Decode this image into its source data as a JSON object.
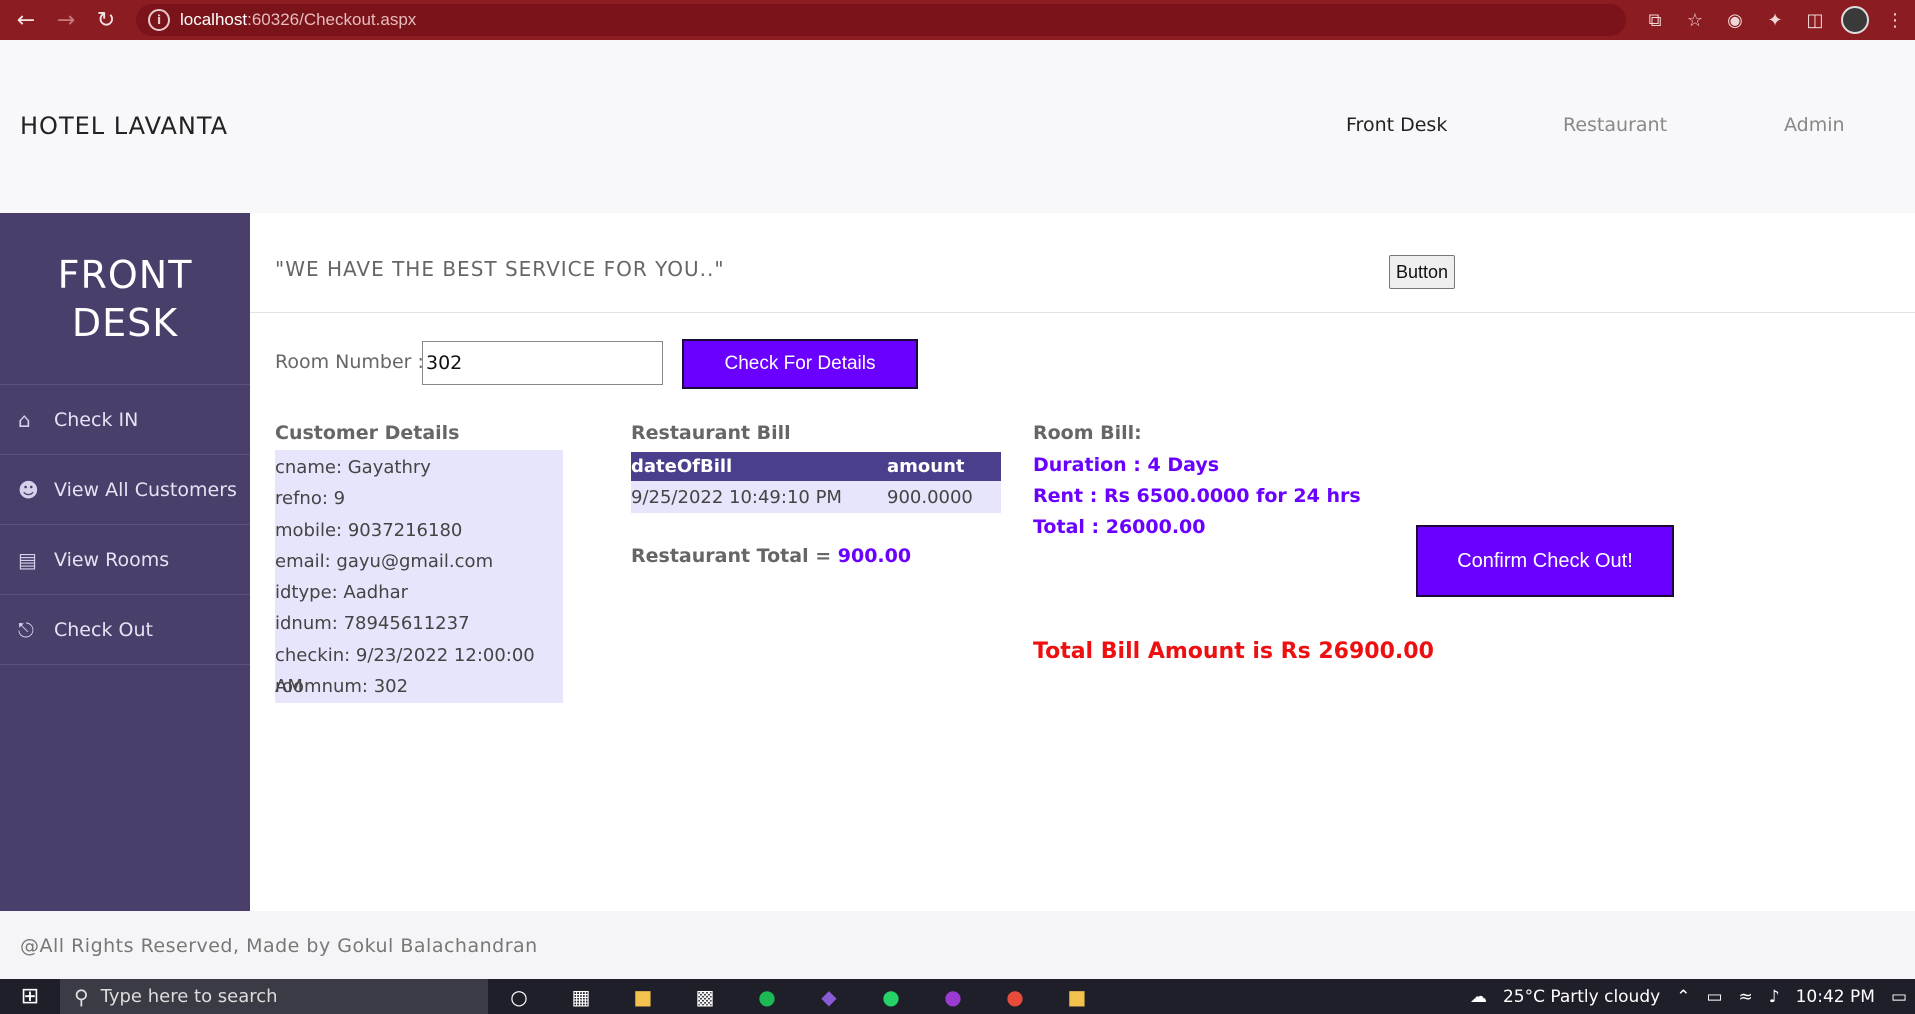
{
  "browser": {
    "url_host": "localhost",
    "url_rest": ":60326/Checkout.aspx"
  },
  "header": {
    "brand": "HOTEL LAVANTA",
    "nav": [
      "Front Desk",
      "Restaurant",
      "Admin"
    ]
  },
  "sidebar": {
    "title_line1": "FRONT",
    "title_line2": "DESK",
    "items": [
      {
        "label": "Check IN",
        "icon": "home-icon"
      },
      {
        "label": "View All Customers",
        "icon": "user-icon"
      },
      {
        "label": "View Rooms",
        "icon": "id-card-icon"
      },
      {
        "label": "Check Out",
        "icon": "sitemap-icon"
      }
    ]
  },
  "main": {
    "tagline": "\"WE HAVE THE BEST SERVICE FOR YOU..\"",
    "plain_button": "Button",
    "room_label": "Room Number :",
    "room_value": "302",
    "check_button": "Check For Details",
    "customer": {
      "title": "Customer Details",
      "lines": [
        "cname: Gayathry",
        "refno: 9",
        "mobile: 9037216180",
        "email: gayu@gmail.com",
        "idtype: Aadhar",
        "idnum: 78945611237",
        "checkin: 9/23/2022 12:00:00 AM",
        "roomnum: 302"
      ]
    },
    "restaurant": {
      "title": "Restaurant Bill",
      "columns": [
        "dateOfBill",
        "amount"
      ],
      "rows": [
        [
          "9/25/2022 10:49:10 PM",
          "900.0000"
        ]
      ],
      "total_label": "Restaurant Total =",
      "total_value": "900.00"
    },
    "room_bill": {
      "title": "Room Bill:",
      "duration": "Duration : 4 Days",
      "rent": "Rent : Rs 6500.0000 for 24 hrs",
      "total": "Total : 26000.00"
    },
    "confirm_button": "Confirm Check Out!",
    "grand_total": "Total Bill Amount is Rs 26900.00"
  },
  "footer": {
    "text": "@All Rights Reserved, Made by Gokul Balachandran"
  },
  "taskbar": {
    "search_placeholder": "Type here to search",
    "weather": "25°C  Partly cloudy",
    "time": "10:42 PM"
  },
  "colors": {
    "accent": "#6a00ff",
    "sidebar": "#4a3f6b",
    "alert": "#ee1010",
    "browser_bar": "#8b1c22"
  }
}
